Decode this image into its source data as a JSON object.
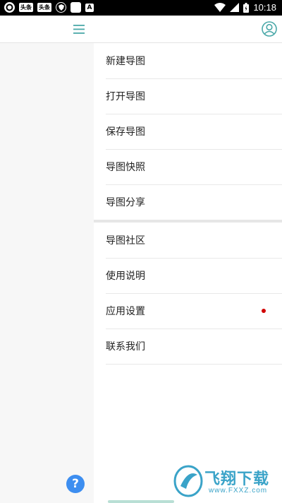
{
  "status_bar": {
    "time": "10:18",
    "icons": [
      "notification-icon",
      "toutiao-icon",
      "toutiao-icon",
      "shield-icon",
      "app-icon",
      "a-icon"
    ],
    "toutiao_label": "头条",
    "a_label": "A"
  },
  "topbar": {
    "menu_icon": "hamburger-menu-icon",
    "user_icon": "user-account-icon"
  },
  "drawer": {
    "group1": [
      {
        "label": "新建导图"
      },
      {
        "label": "打开导图"
      },
      {
        "label": "保存导图"
      },
      {
        "label": "导图快照"
      },
      {
        "label": "导图分享"
      }
    ],
    "group2": [
      {
        "label": "导图社区"
      },
      {
        "label": "使用说明"
      },
      {
        "label": "应用设置",
        "badge": "red-dot"
      },
      {
        "label": "联系我们"
      }
    ]
  },
  "help_button": {
    "label": "?"
  },
  "watermark": {
    "text": "飞翔下载",
    "url": "www.FXXZ.com"
  },
  "colors": {
    "accent": "#4aa8a8",
    "badge": "#d10000",
    "help": "#3d8ef0"
  }
}
